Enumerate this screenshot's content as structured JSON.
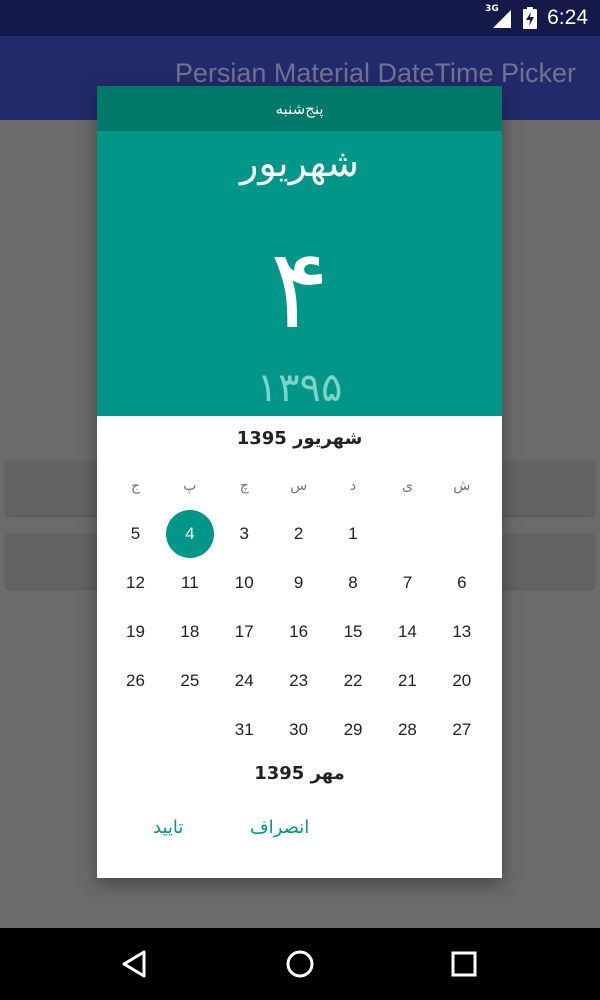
{
  "status_bar": {
    "network_label": "3G",
    "time": "6:24",
    "icons": [
      "signal-icon",
      "battery-charging-icon"
    ]
  },
  "app_bar": {
    "title": "Persian Material DateTime Picker"
  },
  "dialog": {
    "weekday_name": "پنج‌شنبه",
    "header_month": "شهریور",
    "header_day": "۴",
    "header_year": "۱۳۹۵",
    "current_month_title": "شهریور 1395",
    "week_days": [
      "ش",
      "ی",
      "د",
      "س",
      "چ",
      "پ",
      "ج"
    ],
    "days_rows": [
      [
        "",
        "",
        "1",
        "2",
        "3",
        "4",
        "5"
      ],
      [
        "6",
        "7",
        "8",
        "9",
        "10",
        "11",
        "12"
      ],
      [
        "13",
        "14",
        "15",
        "16",
        "17",
        "18",
        "19"
      ],
      [
        "20",
        "21",
        "22",
        "23",
        "24",
        "25",
        "26"
      ],
      [
        "27",
        "28",
        "29",
        "30",
        "31",
        "",
        ""
      ]
    ],
    "selected_day": "4",
    "next_month_title": "مهر 1395",
    "cancel_label": "انصراف",
    "confirm_label": "تایید"
  },
  "colors": {
    "accent": "#009688",
    "accent_dark": "#00796b",
    "status_bar": "#15194a",
    "app_bar": "#232a6b"
  }
}
